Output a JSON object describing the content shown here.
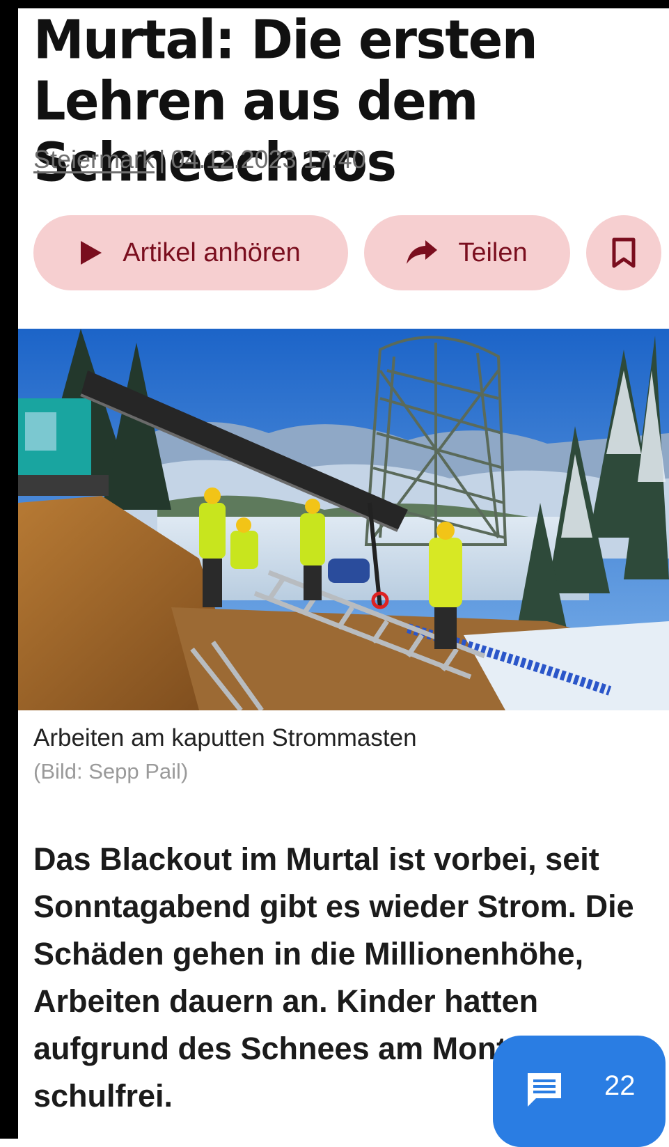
{
  "article": {
    "headline": "Murtal: Die ersten Lehren aus dem Schneechaos",
    "section": "Steiermark",
    "separator": "|",
    "datetime": "04.12.2023 17:40"
  },
  "actions": {
    "listen_label": "Artikel anhören",
    "share_label": "Teilen",
    "bookmark_icon": "bookmark-icon"
  },
  "image": {
    "caption": "Arbeiten am kaputten Strommasten",
    "credit": "(Bild: Sepp Pail)"
  },
  "lead": "Das Blackout im Murtal ist vorbei, seit Sonntagabend gibt es wieder Strom. Die Schäden gehen in die Millionenhöhe, Arbeiten dauern an. Kinder hatten aufgrund des Schnees am Montag schulfrei.",
  "comments": {
    "count": "22",
    "icon": "comment-icon"
  },
  "colors": {
    "action_bg": "#f6cfd0",
    "action_fg": "#7a0e1e",
    "comments_bg": "#2a7de3"
  }
}
